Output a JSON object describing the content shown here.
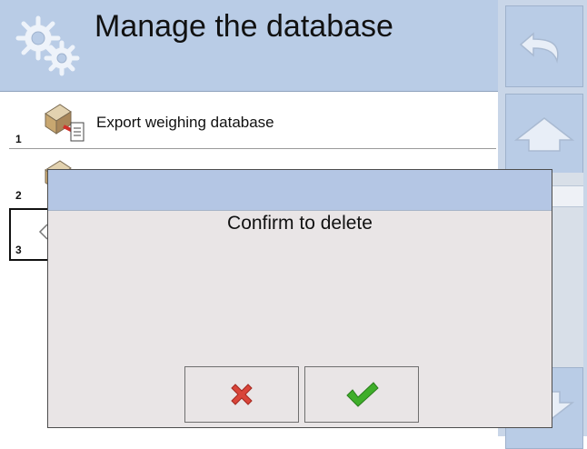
{
  "header": {
    "title": "Manage the database",
    "icon": "gears-icon"
  },
  "list": {
    "items": [
      {
        "number": "1",
        "label": "Export weighing database",
        "icon": "export-database-icon"
      },
      {
        "number": "2",
        "label": "",
        "icon": "database-icon"
      },
      {
        "number": "3",
        "label": "",
        "icon": "delete-database-icon"
      }
    ]
  },
  "sidebar": {
    "back_icon": "back-arrow-icon",
    "up_icon": "up-arrow-icon",
    "down_icon": "down-arrow-icon"
  },
  "dialog": {
    "message": "Confirm to delete",
    "cancel_icon": "red-x-icon",
    "confirm_icon": "green-check-icon"
  },
  "colors": {
    "header_bg": "#b9cce6",
    "dialog_bg": "#e9e5e6",
    "cancel": "#d9453a",
    "confirm": "#3fae2a"
  }
}
